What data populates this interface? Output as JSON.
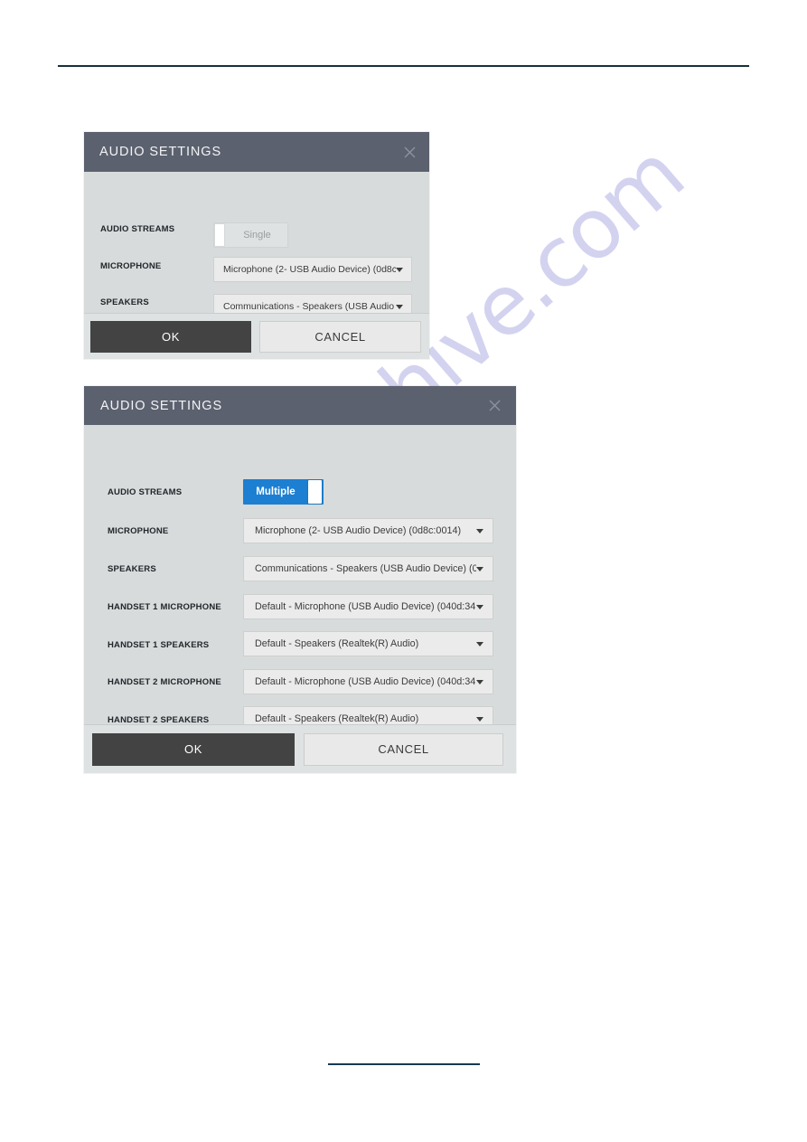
{
  "page": {
    "watermark_text": "manualshive.com",
    "watermark_color": "#b9b9e8",
    "top_rule_color": "#17303c",
    "bottom_rule_color": "#17394f"
  },
  "colors": {
    "header_bg": "#5c616f",
    "dialog_bg": "#d7dbdb",
    "footer_bg": "#dfe2e2",
    "toggle_on": "#1d7fd1",
    "ok_button": "#434343",
    "cancel_button": "#e9e9e9",
    "select_bg": "#ebebeb"
  },
  "dialog_single": {
    "title": "AUDIO SETTINGS",
    "close_icon": "close-icon",
    "fields": [
      {
        "label": "AUDIO STREAMS",
        "type": "toggle",
        "value": "Single",
        "state": "off"
      },
      {
        "label": "MICROPHONE",
        "type": "select",
        "value": "Microphone (2- USB Audio Device) (0d8c"
      },
      {
        "label": "SPEAKERS",
        "type": "select",
        "value": "Communications - Speakers (USB Audio"
      }
    ],
    "buttons": {
      "ok": "OK",
      "cancel": "CANCEL"
    }
  },
  "dialog_multiple": {
    "title": "AUDIO SETTINGS",
    "close_icon": "close-icon",
    "fields": [
      {
        "label": "AUDIO STREAMS",
        "type": "toggle",
        "value": "Multiple",
        "state": "on"
      },
      {
        "label": "MICROPHONE",
        "type": "select",
        "value": "Microphone (2- USB Audio Device) (0d8c:0014)"
      },
      {
        "label": "SPEAKERS",
        "type": "select",
        "value": "Communications - Speakers (USB Audio Device) (0"
      },
      {
        "label": "HANDSET 1 MICROPHONE",
        "type": "select",
        "value": "Default - Microphone (USB Audio Device) (040d:34"
      },
      {
        "label": "HANDSET 1 SPEAKERS",
        "type": "select",
        "value": "Default - Speakers (Realtek(R) Audio)"
      },
      {
        "label": "HANDSET 2 MICROPHONE",
        "type": "select",
        "value": "Default - Microphone (USB Audio Device) (040d:34"
      },
      {
        "label": "HANDSET 2 SPEAKERS",
        "type": "select",
        "value": "Default - Speakers (Realtek(R) Audio)"
      }
    ],
    "buttons": {
      "ok": "OK",
      "cancel": "CANCEL"
    }
  }
}
